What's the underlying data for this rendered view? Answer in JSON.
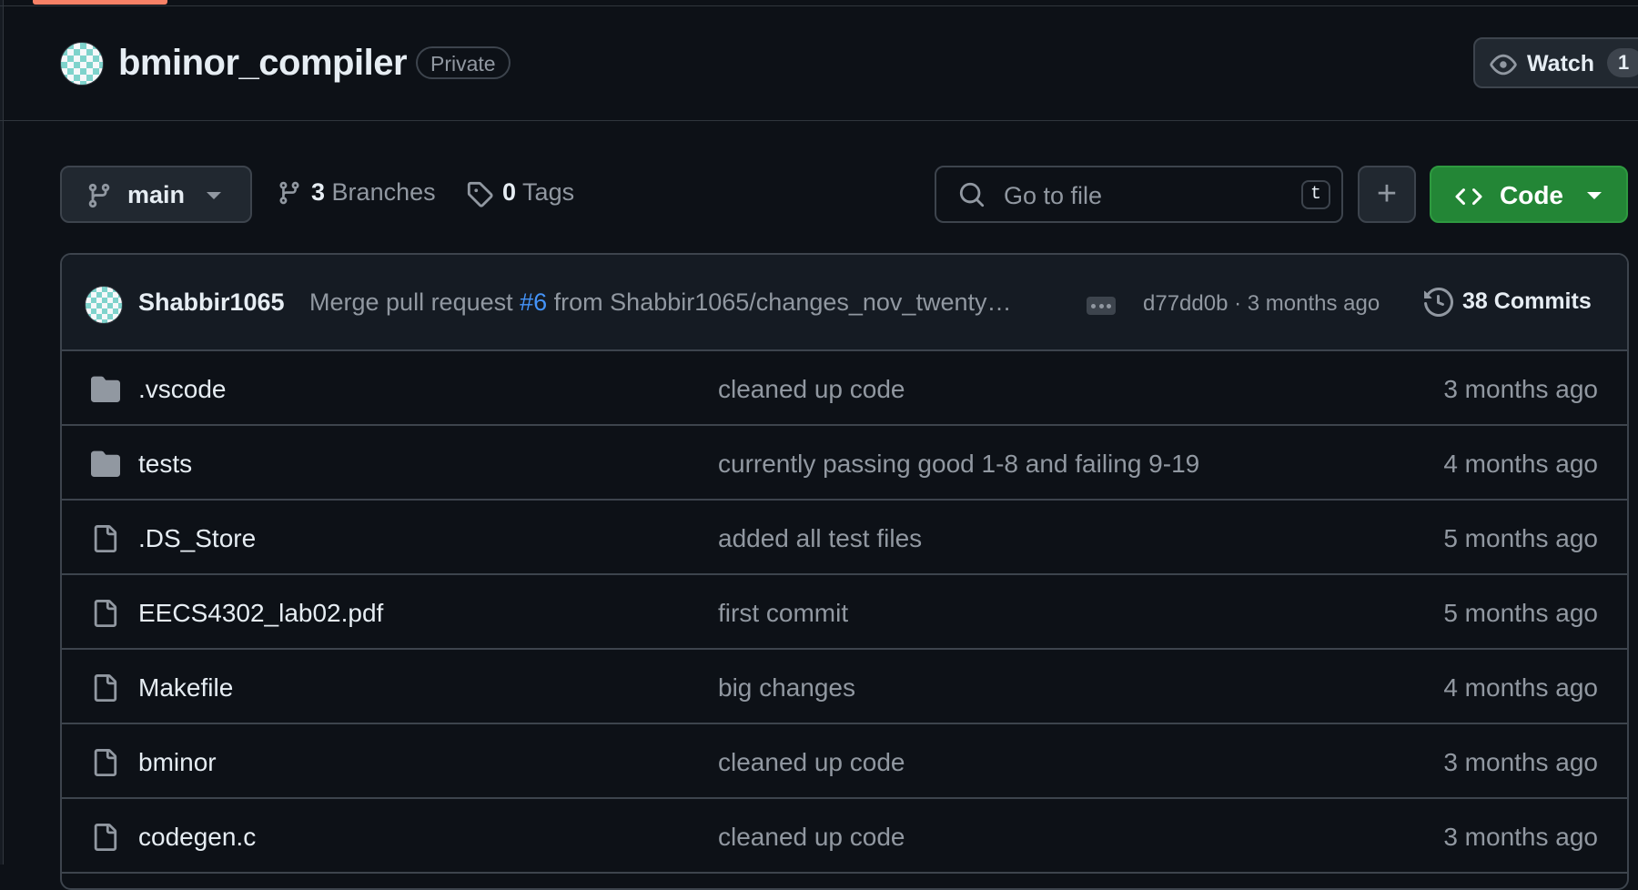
{
  "repo": {
    "name": "bminor_compiler",
    "visibility": "Private",
    "watch_label": "Watch",
    "watch_count": "1"
  },
  "toolbar": {
    "branch": "main",
    "branches_count": "3",
    "branches_label": "Branches",
    "tags_count": "0",
    "tags_label": "Tags",
    "search_placeholder": "Go to file",
    "search_shortcut": "t",
    "add_label": "+",
    "code_label": "Code"
  },
  "latest_commit": {
    "author": "Shabbir1065",
    "message_prefix": "Merge pull request ",
    "pr_link": "#6",
    "message_suffix": " from Shabbir1065/changes_nov_twenty…",
    "hash_age": "d77dd0b · 3 months ago",
    "commits_count": "38",
    "commits_label": "Commits"
  },
  "files": [
    {
      "type": "folder",
      "icon": "folder-icon",
      "name": ".vscode",
      "message": "cleaned up code",
      "age": "3 months ago"
    },
    {
      "type": "folder",
      "icon": "folder-icon",
      "name": "tests",
      "message": "currently passing good 1-8 and failing 9-19",
      "age": "4 months ago"
    },
    {
      "type": "file",
      "icon": "file-icon",
      "name": ".DS_Store",
      "message": "added all test files",
      "age": "5 months ago"
    },
    {
      "type": "file",
      "icon": "file-icon",
      "name": "EECS4302_lab02.pdf",
      "message": "first commit",
      "age": "5 months ago"
    },
    {
      "type": "file",
      "icon": "file-icon",
      "name": "Makefile",
      "message": "big changes",
      "age": "4 months ago"
    },
    {
      "type": "file",
      "icon": "file-icon",
      "name": "bminor",
      "message": "cleaned up code",
      "age": "3 months ago"
    },
    {
      "type": "file",
      "icon": "file-icon",
      "name": "codegen.c",
      "message": "cleaned up code",
      "age": "3 months ago"
    }
  ],
  "colors": {
    "background": "#0d1117",
    "border": "#3d444d",
    "text": "#e6edf3",
    "muted": "#9198a1",
    "link": "#4493f8",
    "code_button": "#238636",
    "tab_accent": "#f78166"
  }
}
